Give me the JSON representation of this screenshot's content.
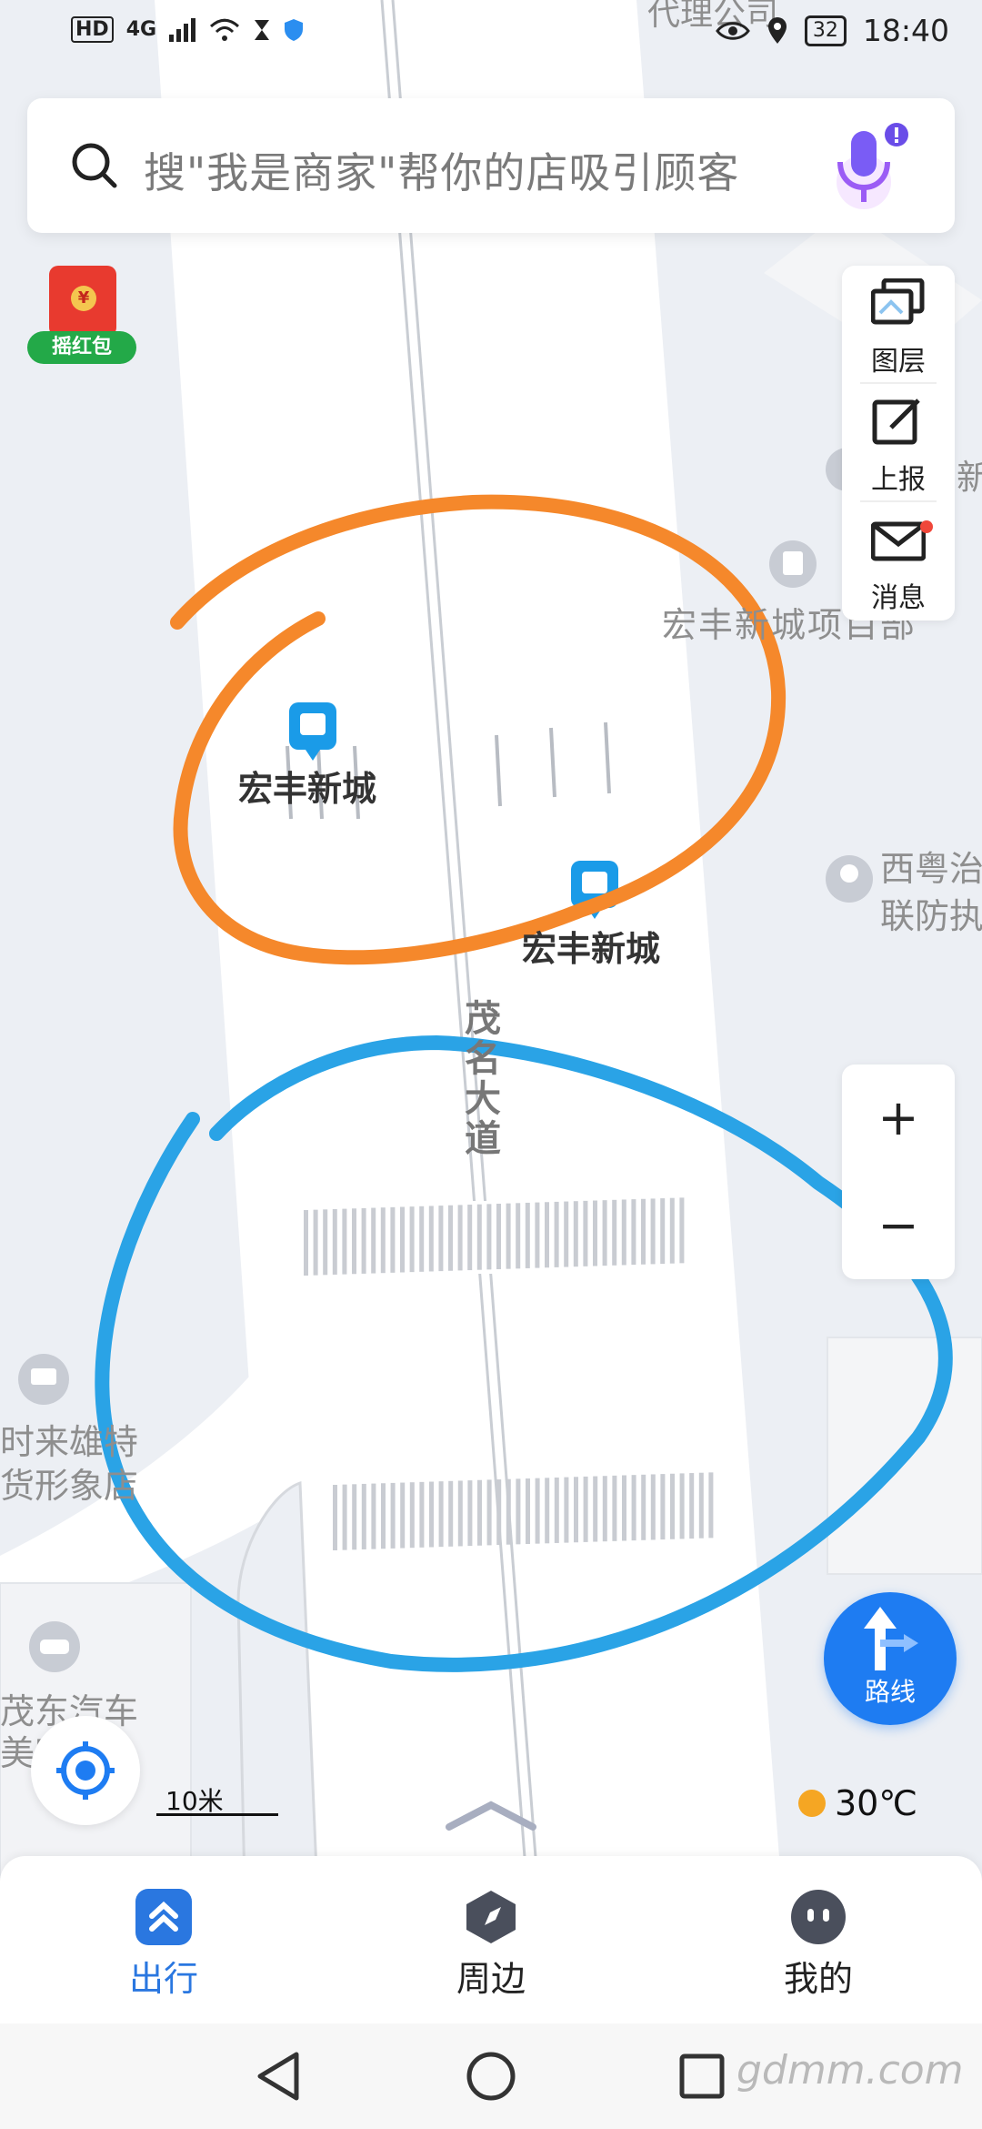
{
  "status_bar": {
    "left_icons": [
      "HD",
      "4G"
    ],
    "time": "18:40",
    "battery": "32"
  },
  "search": {
    "placeholder": "搜\"我是商家\"帮你的店吸引顾客"
  },
  "red_packet": {
    "label": "摇红包",
    "coin": "¥"
  },
  "tools": [
    {
      "label": "图层",
      "icon": "layers-icon"
    },
    {
      "label": "上报",
      "icon": "report-icon"
    },
    {
      "label": "消息",
      "icon": "message-icon"
    }
  ],
  "map_labels": {
    "top_company": "代理公司",
    "poi_project": "宏丰新城项目部",
    "right_edge_new": "新",
    "bus_stop_1": "宏丰新城",
    "bus_stop_2": "宏丰新城",
    "west_top": "西粤治",
    "west_bottom": "联防执",
    "road": "茂名大道",
    "shop_line1": "时来雄特",
    "shop_line2": "货形象店",
    "car_line1": "茂东汽车",
    "car_line2": "美容"
  },
  "zoom": {
    "plus": "+",
    "minus": "−"
  },
  "scale": "10米",
  "weather": {
    "temp": "30℃"
  },
  "route_button": "路线",
  "bottom_nav": [
    {
      "label": "出行",
      "active": true
    },
    {
      "label": "周边",
      "active": false
    },
    {
      "label": "我的",
      "active": false
    }
  ],
  "watermark": "gdmm.com",
  "colors": {
    "accent": "#1e7cf2",
    "orange_annotation": "#f5882b",
    "blue_annotation": "#2aa3e6",
    "bus_icon": "#1a9be8"
  }
}
